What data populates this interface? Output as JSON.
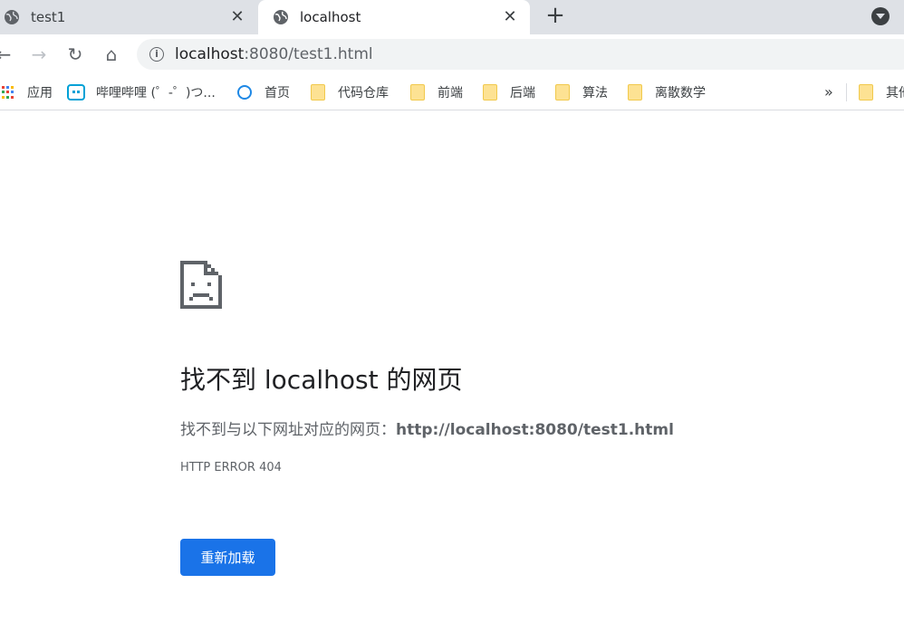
{
  "tabs": [
    {
      "title": "test1",
      "active": false
    },
    {
      "title": "localhost",
      "active": true
    }
  ],
  "tab_close_glyph": "✕",
  "new_tab_glyph": "+",
  "toolbar": {
    "back_glyph": "←",
    "forward_glyph": "→",
    "reload_glyph": "↻",
    "home_glyph": "⌂",
    "info_glyph": "i",
    "url_host": "localhost",
    "url_rest": ":8080/test1.html"
  },
  "bookmarks": [
    {
      "label": "应用",
      "icon": "apps-grid-icon"
    },
    {
      "label": "哔哩哔哩 (゜-゜)つ...",
      "icon": "bilibili-icon"
    },
    {
      "label": "首页",
      "icon": "homepage-icon"
    },
    {
      "label": "代码仓库",
      "icon": "folder-icon"
    },
    {
      "label": "前端",
      "icon": "folder-icon"
    },
    {
      "label": "后端",
      "icon": "folder-icon"
    },
    {
      "label": "算法",
      "icon": "folder-icon"
    },
    {
      "label": "离散数学",
      "icon": "folder-icon"
    },
    {
      "label": "其他书签",
      "icon": "folder-icon"
    }
  ],
  "bookmarks_more": "»",
  "error": {
    "title": "找不到 localhost 的网页",
    "desc_prefix": "找不到与以下网址对应的网页：",
    "desc_url": "http://localhost:8080/test1.html",
    "code": "HTTP ERROR 404",
    "reload_label": "重新加载"
  },
  "colors": {
    "accent": "#1a73e8",
    "tabstrip": "#dee1e6"
  }
}
